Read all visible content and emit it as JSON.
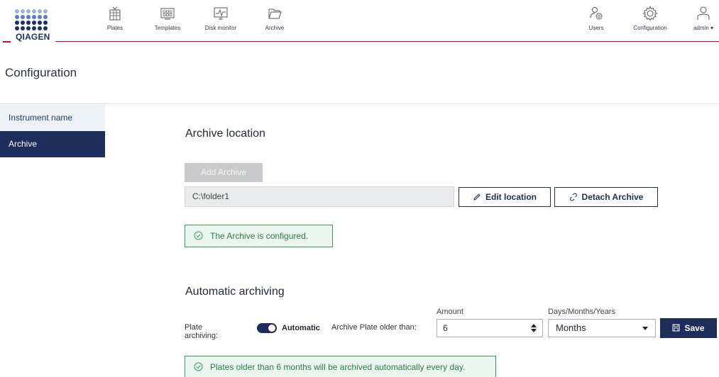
{
  "brand": {
    "name": "QIAGEN",
    "color": "#1c2e6e",
    "accent_red": "#c8102e"
  },
  "nav_left": [
    {
      "label": "Plates",
      "icon": "plate-icon"
    },
    {
      "label": "Templates",
      "icon": "template-icon"
    },
    {
      "label": "Disk monitor",
      "icon": "monitor-icon"
    },
    {
      "label": "Archive",
      "icon": "folder-icon"
    }
  ],
  "nav_right": [
    {
      "label": "Users",
      "icon": "users-icon"
    },
    {
      "label": "Configuration",
      "icon": "gear-icon"
    },
    {
      "label": "admin ▾",
      "icon": "user-icon"
    }
  ],
  "page": {
    "title": "Configuration"
  },
  "sidebar": {
    "items": [
      {
        "label": "Instrument name",
        "active": false
      },
      {
        "label": "Archive",
        "active": true
      }
    ]
  },
  "archive_location": {
    "title": "Archive location",
    "add_button": "Add Archive",
    "path": "C:\\folder1",
    "edit_button": "Edit location",
    "detach_button": "Detach Archive",
    "status": "The Archive is configured."
  },
  "automatic_archiving": {
    "title": "Automatic archiving",
    "plate_archiving_label": "Plate archiving:",
    "toggle_label": "Automatic",
    "toggle_on": true,
    "older_than_label": "Archive Plate older than:",
    "amount_label": "Amount",
    "amount_value": "6",
    "unit_label": "Days/Months/Years",
    "unit_value": "Months",
    "save_button": "Save",
    "info": "Plates older than 6 months will be archived automatically every day."
  },
  "colors": {
    "primary": "#1c2d5a",
    "success_bg": "#ebf6ef",
    "success_border": "#3a9a5c"
  }
}
